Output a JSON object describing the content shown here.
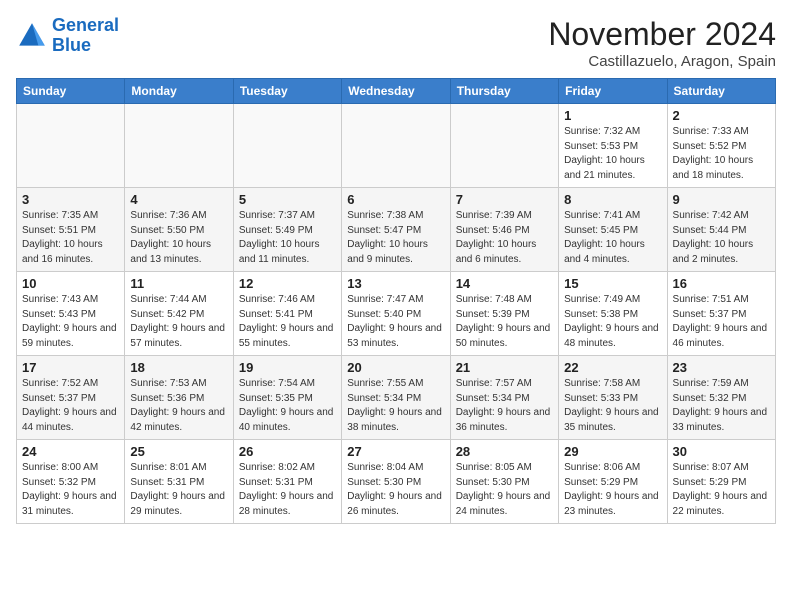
{
  "header": {
    "logo_line1": "General",
    "logo_line2": "Blue",
    "month": "November 2024",
    "location": "Castillazuelo, Aragon, Spain"
  },
  "weekdays": [
    "Sunday",
    "Monday",
    "Tuesday",
    "Wednesday",
    "Thursday",
    "Friday",
    "Saturday"
  ],
  "weeks": [
    [
      {
        "day": "",
        "info": ""
      },
      {
        "day": "",
        "info": ""
      },
      {
        "day": "",
        "info": ""
      },
      {
        "day": "",
        "info": ""
      },
      {
        "day": "",
        "info": ""
      },
      {
        "day": "1",
        "info": "Sunrise: 7:32 AM\nSunset: 5:53 PM\nDaylight: 10 hours and 21 minutes."
      },
      {
        "day": "2",
        "info": "Sunrise: 7:33 AM\nSunset: 5:52 PM\nDaylight: 10 hours and 18 minutes."
      }
    ],
    [
      {
        "day": "3",
        "info": "Sunrise: 7:35 AM\nSunset: 5:51 PM\nDaylight: 10 hours and 16 minutes."
      },
      {
        "day": "4",
        "info": "Sunrise: 7:36 AM\nSunset: 5:50 PM\nDaylight: 10 hours and 13 minutes."
      },
      {
        "day": "5",
        "info": "Sunrise: 7:37 AM\nSunset: 5:49 PM\nDaylight: 10 hours and 11 minutes."
      },
      {
        "day": "6",
        "info": "Sunrise: 7:38 AM\nSunset: 5:47 PM\nDaylight: 10 hours and 9 minutes."
      },
      {
        "day": "7",
        "info": "Sunrise: 7:39 AM\nSunset: 5:46 PM\nDaylight: 10 hours and 6 minutes."
      },
      {
        "day": "8",
        "info": "Sunrise: 7:41 AM\nSunset: 5:45 PM\nDaylight: 10 hours and 4 minutes."
      },
      {
        "day": "9",
        "info": "Sunrise: 7:42 AM\nSunset: 5:44 PM\nDaylight: 10 hours and 2 minutes."
      }
    ],
    [
      {
        "day": "10",
        "info": "Sunrise: 7:43 AM\nSunset: 5:43 PM\nDaylight: 9 hours and 59 minutes."
      },
      {
        "day": "11",
        "info": "Sunrise: 7:44 AM\nSunset: 5:42 PM\nDaylight: 9 hours and 57 minutes."
      },
      {
        "day": "12",
        "info": "Sunrise: 7:46 AM\nSunset: 5:41 PM\nDaylight: 9 hours and 55 minutes."
      },
      {
        "day": "13",
        "info": "Sunrise: 7:47 AM\nSunset: 5:40 PM\nDaylight: 9 hours and 53 minutes."
      },
      {
        "day": "14",
        "info": "Sunrise: 7:48 AM\nSunset: 5:39 PM\nDaylight: 9 hours and 50 minutes."
      },
      {
        "day": "15",
        "info": "Sunrise: 7:49 AM\nSunset: 5:38 PM\nDaylight: 9 hours and 48 minutes."
      },
      {
        "day": "16",
        "info": "Sunrise: 7:51 AM\nSunset: 5:37 PM\nDaylight: 9 hours and 46 minutes."
      }
    ],
    [
      {
        "day": "17",
        "info": "Sunrise: 7:52 AM\nSunset: 5:37 PM\nDaylight: 9 hours and 44 minutes."
      },
      {
        "day": "18",
        "info": "Sunrise: 7:53 AM\nSunset: 5:36 PM\nDaylight: 9 hours and 42 minutes."
      },
      {
        "day": "19",
        "info": "Sunrise: 7:54 AM\nSunset: 5:35 PM\nDaylight: 9 hours and 40 minutes."
      },
      {
        "day": "20",
        "info": "Sunrise: 7:55 AM\nSunset: 5:34 PM\nDaylight: 9 hours and 38 minutes."
      },
      {
        "day": "21",
        "info": "Sunrise: 7:57 AM\nSunset: 5:34 PM\nDaylight: 9 hours and 36 minutes."
      },
      {
        "day": "22",
        "info": "Sunrise: 7:58 AM\nSunset: 5:33 PM\nDaylight: 9 hours and 35 minutes."
      },
      {
        "day": "23",
        "info": "Sunrise: 7:59 AM\nSunset: 5:32 PM\nDaylight: 9 hours and 33 minutes."
      }
    ],
    [
      {
        "day": "24",
        "info": "Sunrise: 8:00 AM\nSunset: 5:32 PM\nDaylight: 9 hours and 31 minutes."
      },
      {
        "day": "25",
        "info": "Sunrise: 8:01 AM\nSunset: 5:31 PM\nDaylight: 9 hours and 29 minutes."
      },
      {
        "day": "26",
        "info": "Sunrise: 8:02 AM\nSunset: 5:31 PM\nDaylight: 9 hours and 28 minutes."
      },
      {
        "day": "27",
        "info": "Sunrise: 8:04 AM\nSunset: 5:30 PM\nDaylight: 9 hours and 26 minutes."
      },
      {
        "day": "28",
        "info": "Sunrise: 8:05 AM\nSunset: 5:30 PM\nDaylight: 9 hours and 24 minutes."
      },
      {
        "day": "29",
        "info": "Sunrise: 8:06 AM\nSunset: 5:29 PM\nDaylight: 9 hours and 23 minutes."
      },
      {
        "day": "30",
        "info": "Sunrise: 8:07 AM\nSunset: 5:29 PM\nDaylight: 9 hours and 22 minutes."
      }
    ]
  ]
}
